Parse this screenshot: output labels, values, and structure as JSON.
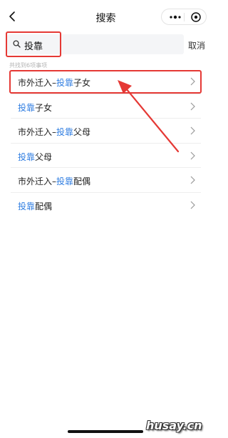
{
  "navbar": {
    "title": "搜索"
  },
  "search": {
    "query": "投靠",
    "cancel_label": "取消"
  },
  "hint": "共找到6项事项",
  "results": [
    {
      "prefix": "市外迁入–",
      "keyword": "投靠",
      "suffix": "子女"
    },
    {
      "prefix": "",
      "keyword": "投靠",
      "suffix": "子女"
    },
    {
      "prefix": "市外迁入–",
      "keyword": "投靠",
      "suffix": "父母"
    },
    {
      "prefix": "",
      "keyword": "投靠",
      "suffix": "父母"
    },
    {
      "prefix": "市外迁入–",
      "keyword": "投靠",
      "suffix": "配偶"
    },
    {
      "prefix": "",
      "keyword": "投靠",
      "suffix": "配偶"
    }
  ],
  "watermark": "husay.cn",
  "colors": {
    "keyword": "#2f7de1",
    "annotation": "#e53935"
  }
}
